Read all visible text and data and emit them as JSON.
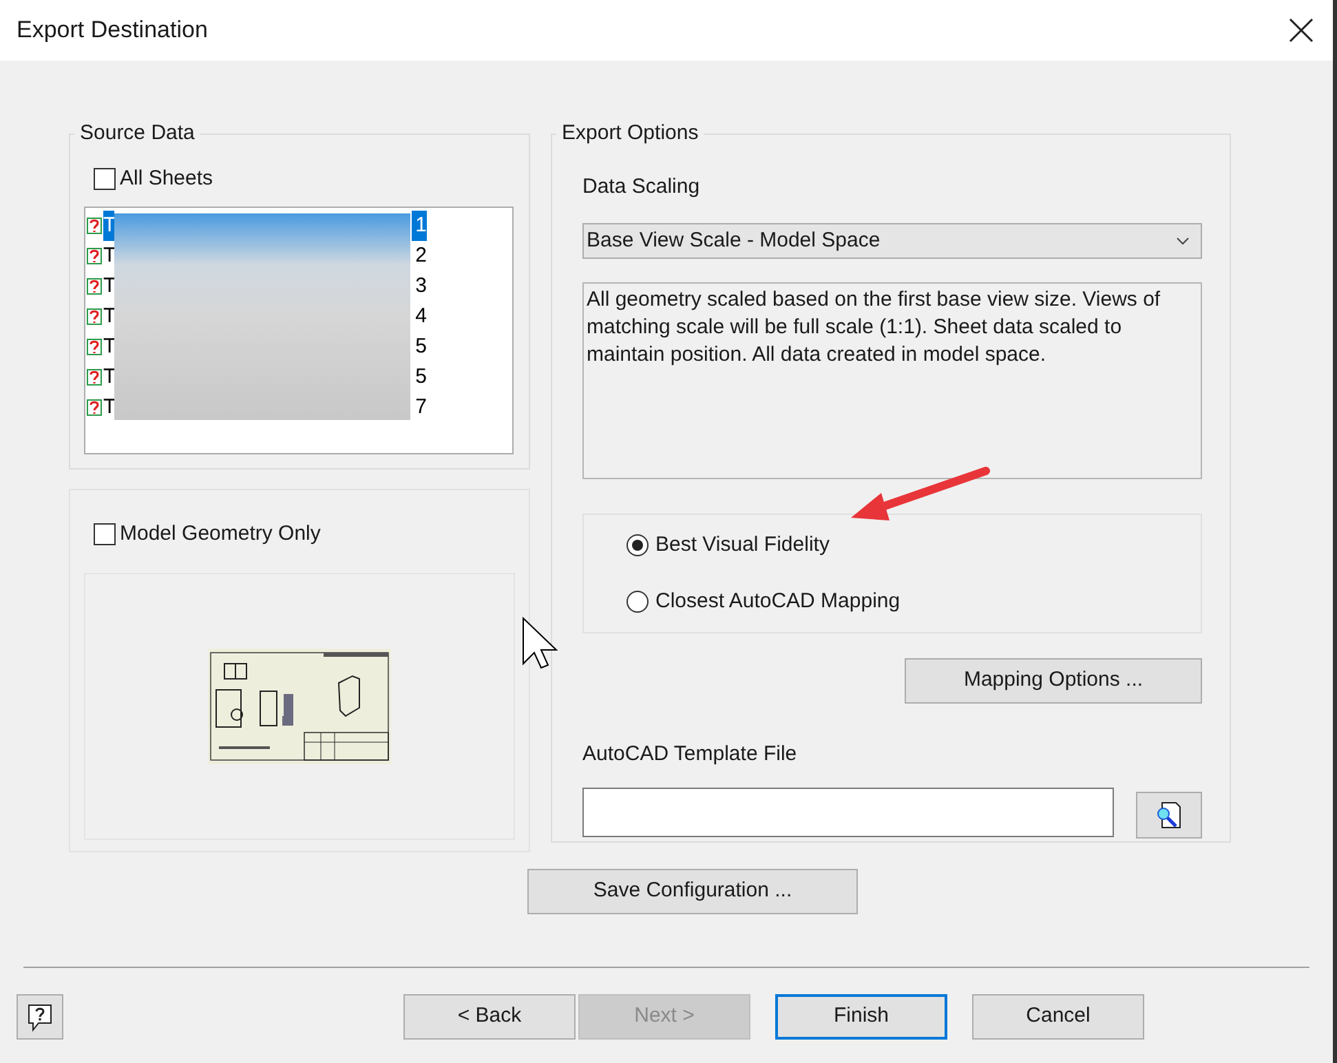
{
  "window": {
    "title": "Export Destination"
  },
  "source_data": {
    "title": "Source Data",
    "all_sheets": {
      "label": "All Sheets",
      "checked": false
    },
    "sheets": [
      {
        "start": "T",
        "end": "1",
        "selected": true
      },
      {
        "start": "T",
        "end": "2",
        "selected": false
      },
      {
        "start": "T",
        "end": "3",
        "selected": false
      },
      {
        "start": "T",
        "end": "4",
        "selected": false
      },
      {
        "start": "T",
        "end": "5",
        "selected": false
      },
      {
        "start": "T",
        "end": "5",
        "selected": false
      },
      {
        "start": "T",
        "end": "7",
        "selected": false
      }
    ]
  },
  "preview": {
    "model_geometry_only": {
      "label": "Model Geometry Only",
      "checked": false
    }
  },
  "export_options": {
    "title": "Export Options",
    "data_scaling_label": "Data Scaling",
    "data_scaling_value": "Base View Scale - Model Space",
    "description": "All geometry scaled based on the first base view size. Views of matching scale will be full scale (1:1). Sheet data scaled to maintain position. All data created in model space.",
    "mapping": [
      {
        "label": "Best Visual Fidelity",
        "selected": true
      },
      {
        "label": "Closest AutoCAD Mapping",
        "selected": false
      }
    ],
    "mapping_options_button": "Mapping Options ...",
    "template_label": "AutoCAD Template File"
  },
  "save_configuration_button": "Save Configuration ...",
  "footer_buttons": [
    {
      "label": "< Back",
      "disabled": false,
      "default": false
    },
    {
      "label": "Next >",
      "disabled": true,
      "default": false
    },
    {
      "label": "Finish",
      "disabled": false,
      "default": true
    },
    {
      "label": "Cancel",
      "disabled": false,
      "default": false
    }
  ]
}
